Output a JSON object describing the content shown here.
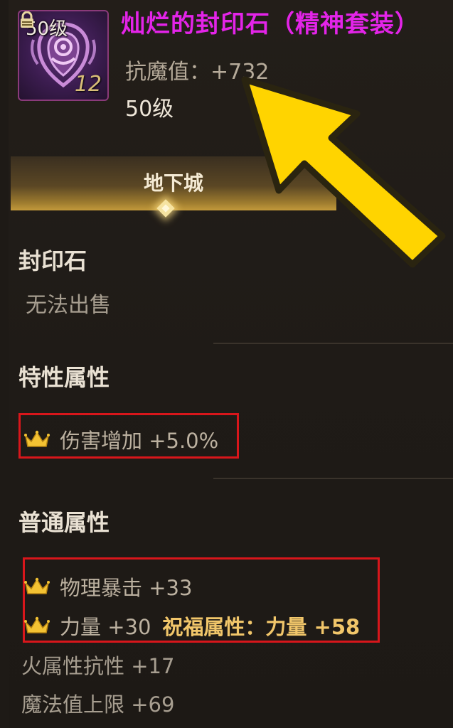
{
  "item": {
    "level_badge": "50级",
    "count": "12",
    "name": "灿烂的封印石（精神套装）",
    "stat": "抗魔值：+732",
    "level": "50级"
  },
  "tab": {
    "label": "地下城"
  },
  "sections": {
    "type_heading": "封印石",
    "type_value": "无法出售",
    "special_heading": "特性属性",
    "special_attr": "伤害增加 +5.0%",
    "normal_heading": "普通属性",
    "normal_attrs": [
      {
        "text": "物理暴击 +33"
      },
      {
        "text": "力量 +30",
        "bless": "祝福属性：力量 +58"
      }
    ],
    "extra_attrs": [
      "火属性抗性 +17",
      "魔法值上限 +69"
    ]
  },
  "colors": {
    "name": "#e324e8",
    "highlight_box": "#d8161b",
    "arrow": "#ffd400",
    "bless_text": "#f1c66a"
  },
  "icons": [
    "seal-stone-icon",
    "lock-icon",
    "crown-icon",
    "arrow-pointer-icon"
  ]
}
